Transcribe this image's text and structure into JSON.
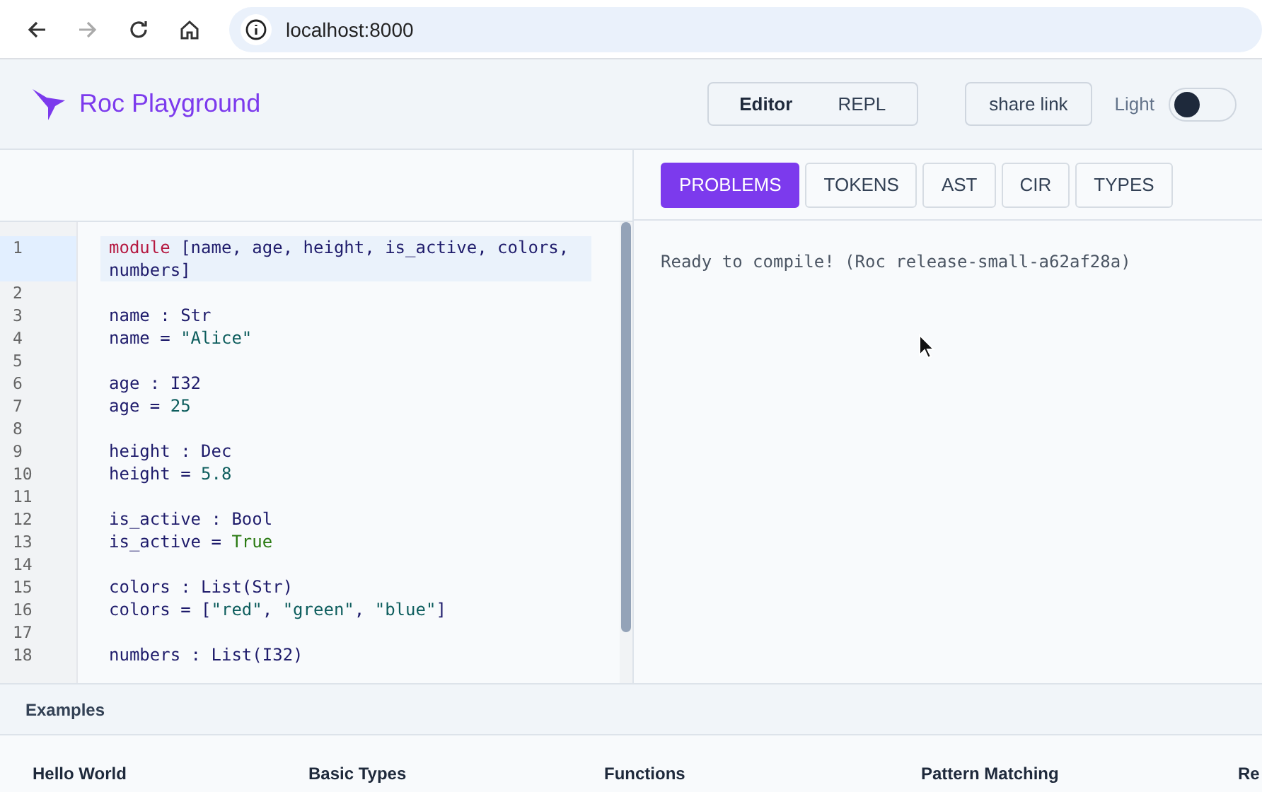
{
  "browser": {
    "url": "localhost:8000"
  },
  "header": {
    "title": "Roc Playground",
    "modes": [
      {
        "label": "Editor",
        "selected": true
      },
      {
        "label": "REPL",
        "selected": false
      }
    ],
    "share": "share link",
    "theme_toggle": {
      "label": "Light",
      "on": false
    }
  },
  "output": {
    "tabs": [
      {
        "label": "PROBLEMS",
        "selected": true
      },
      {
        "label": "TOKENS",
        "selected": false
      },
      {
        "label": "AST",
        "selected": false
      },
      {
        "label": "CIR",
        "selected": false
      },
      {
        "label": "TYPES",
        "selected": false
      }
    ],
    "message": "Ready to compile! (Roc release-small-a62af28a)"
  },
  "editor": {
    "lines": [
      {
        "number": "1",
        "selected": true,
        "tokens": [
          {
            "text": "module",
            "kind": "keyword"
          },
          {
            "text": " [name, age, height, is_active, colors, numbers]",
            "kind": "ident"
          }
        ]
      },
      {
        "number": "2",
        "selected": false
      },
      {
        "number": "3",
        "selected": false,
        "tokens": [
          {
            "text": "name : Str",
            "kind": "ident"
          }
        ]
      },
      {
        "number": "4",
        "selected": false,
        "tokens": [
          {
            "text": "name = ",
            "kind": "ident"
          },
          {
            "text": "\"Alice\"",
            "kind": "string"
          }
        ]
      },
      {
        "number": "5",
        "selected": false
      },
      {
        "number": "6",
        "selected": false,
        "tokens": [
          {
            "text": "age : I32",
            "kind": "ident"
          }
        ]
      },
      {
        "number": "7",
        "selected": false,
        "tokens": [
          {
            "text": "age = ",
            "kind": "ident"
          },
          {
            "text": "25",
            "kind": "number"
          }
        ]
      },
      {
        "number": "8",
        "selected": false
      },
      {
        "number": "9",
        "selected": false,
        "tokens": [
          {
            "text": "height : Dec",
            "kind": "ident"
          }
        ]
      },
      {
        "number": "10",
        "selected": false,
        "tokens": [
          {
            "text": "height = ",
            "kind": "ident"
          },
          {
            "text": "5.8",
            "kind": "number"
          }
        ]
      },
      {
        "number": "11",
        "selected": false
      },
      {
        "number": "12",
        "selected": false,
        "tokens": [
          {
            "text": "is_active : Bool",
            "kind": "ident"
          }
        ]
      },
      {
        "number": "13",
        "selected": false,
        "tokens": [
          {
            "text": "is_active = ",
            "kind": "ident"
          },
          {
            "text": "True",
            "kind": "tag"
          }
        ]
      },
      {
        "number": "14",
        "selected": false
      },
      {
        "number": "15",
        "selected": false,
        "tokens": [
          {
            "text": "colors : List(Str)",
            "kind": "ident"
          }
        ]
      },
      {
        "number": "16",
        "selected": false,
        "tokens": [
          {
            "text": "colors = [",
            "kind": "ident"
          },
          {
            "text": "\"red\"",
            "kind": "string"
          },
          {
            "text": ", ",
            "kind": "ident"
          },
          {
            "text": "\"green\"",
            "kind": "string"
          },
          {
            "text": ", ",
            "kind": "ident"
          },
          {
            "text": "\"blue\"",
            "kind": "string"
          },
          {
            "text": "]",
            "kind": "ident"
          }
        ]
      },
      {
        "number": "17",
        "selected": false
      },
      {
        "number": "18",
        "selected": false,
        "tokens": [
          {
            "text": "numbers : List(I32)",
            "kind": "ident"
          }
        ]
      }
    ]
  },
  "examples": {
    "title": "Examples",
    "items": [
      "Hello World",
      "Basic Types",
      "Functions",
      "Pattern Matching",
      "Re"
    ]
  }
}
